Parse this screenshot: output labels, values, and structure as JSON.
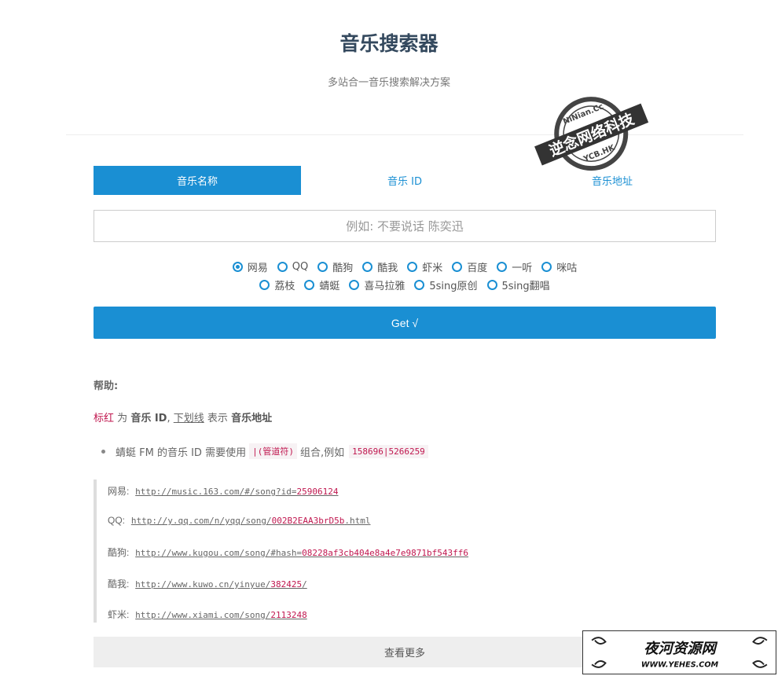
{
  "header": {
    "title": "音乐搜索器",
    "subtitle": "多站合一音乐搜索解决方案"
  },
  "tabs": [
    {
      "label": "音乐名称",
      "active": true
    },
    {
      "label": "音乐 ID",
      "active": false
    },
    {
      "label": "音乐地址",
      "active": false
    }
  ],
  "search": {
    "value": "",
    "placeholder": "例如: 不要说话 陈奕迅"
  },
  "sources": {
    "row1": [
      "网易",
      "QQ",
      "酷狗",
      "酷我",
      "虾米",
      "百度",
      "一听",
      "咪咕"
    ],
    "row2": [
      "荔枝",
      "蜻蜓",
      "喜马拉雅",
      "5sing原创",
      "5sing翻唱"
    ],
    "selected": "网易"
  },
  "submit_label": "Get √",
  "help": {
    "title": "帮助:",
    "red_text": "标红",
    "w1": "为",
    "bold1": "音乐 ID",
    "sep": ",",
    "underline_text": "下划线",
    "w2": "表示",
    "bold2": "音乐地址",
    "bullet_before": "蜻蜓 FM 的音乐 ID 需要使用",
    "bullet_code1": "|(管道符)",
    "bullet_after": "组合,例如",
    "bullet_code2": "158696|5266259"
  },
  "examples": [
    {
      "site": "网易:",
      "prefix": "http://music.163.com/#/song?id=",
      "id": "25906124"
    },
    {
      "site": "QQ:",
      "prefix": "http://y.qq.com/n/yqq/song/",
      "id": "002B2EAA3brD5b",
      "suffix": ".html"
    },
    {
      "site": "酷狗:",
      "prefix": "http://www.kugou.com/song/#hash=",
      "id": "08228af3cb404e8a4e7e9871bf543ff6"
    },
    {
      "site": "酷我:",
      "prefix": "http://www.kuwo.cn/yinyue/",
      "id": "382425",
      "suffix": "/"
    },
    {
      "site": "虾米:",
      "prefix": "http://www.xiami.com/song/",
      "id": "2113248"
    }
  ],
  "more_label": "查看更多",
  "stamp": {
    "top": "NiNian.Cc",
    "main": "逆念网络科技",
    "bottom": "YCB.HK"
  },
  "watermark": {
    "main": "夜河资源网",
    "url": "WWW.YEHES.COM"
  },
  "colors": {
    "accent": "#1a8fd3",
    "highlight": "#c0174f",
    "title": "#34495e"
  }
}
